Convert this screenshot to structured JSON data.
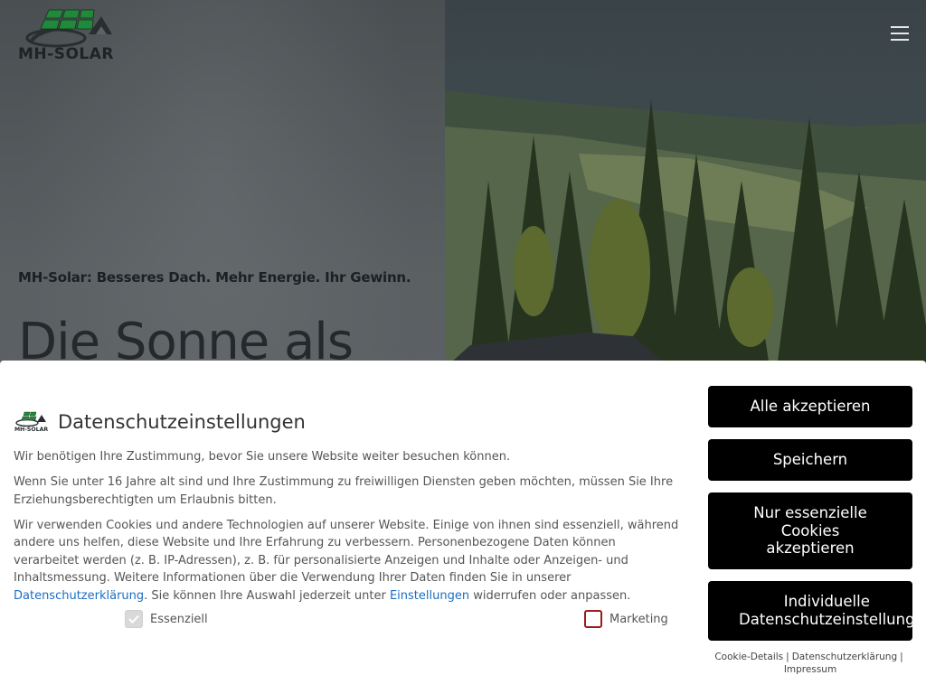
{
  "site": {
    "logo_text": "MH-SOLAR",
    "brand_green": "#1f8a3a",
    "tagline": "MH-Solar: Besseres Dach. Mehr Energie. Ihr Gewinn.",
    "heading": "Die Sonne als",
    "menu_icon": "hamburger-menu-icon"
  },
  "consent": {
    "title": "Datenschutzeinstellungen",
    "logo_text": "MH-SOLAR",
    "intro": "Wir benötigen Ihre Zustimmung, bevor Sie unsere Website weiter besuchen können.",
    "minors": "Wenn Sie unter 16 Jahre alt sind und Ihre Zustimmung zu freiwilligen Diensten geben möchten, müssen Sie Ihre Erziehungsberechtigten um Erlaubnis bitten.",
    "cookies_part1": "Wir verwenden Cookies und andere Technologien auf unserer Website. Einige von ihnen sind essenziell, während andere uns helfen, diese Website und Ihre Erfahrung zu verbessern. Personenbezogene Daten können verarbeitet werden (z. B. IP-Adressen), z. B. für personalisierte Anzeigen und Inhalte oder Anzeigen- und Inhaltsmessung. Weitere Informationen über die Verwendung Ihrer Daten finden Sie in unserer ",
    "privacy_link": "Datenschutzerklärung",
    "cookies_part2": ". Sie können Ihre Auswahl jederzeit unter ",
    "settings_link": "Einstellungen",
    "cookies_part3": " widerrufen oder anpassen.",
    "checkboxes": {
      "essential": {
        "label": "Essenziell",
        "checked": true
      },
      "marketing": {
        "label": "Marketing",
        "checked": false
      }
    },
    "buttons": {
      "accept_all": "Alle akzeptieren",
      "save": "Speichern",
      "essential_only": "Nur essenzielle Cookies akzeptieren",
      "individual_1": "Individuelle",
      "individual_2": "Datenschutzeinstellung"
    },
    "footer": {
      "cookie_details": "Cookie-Details",
      "privacy": "Datenschutzerklärung",
      "imprint": "Impressum",
      "separator": "|"
    }
  }
}
